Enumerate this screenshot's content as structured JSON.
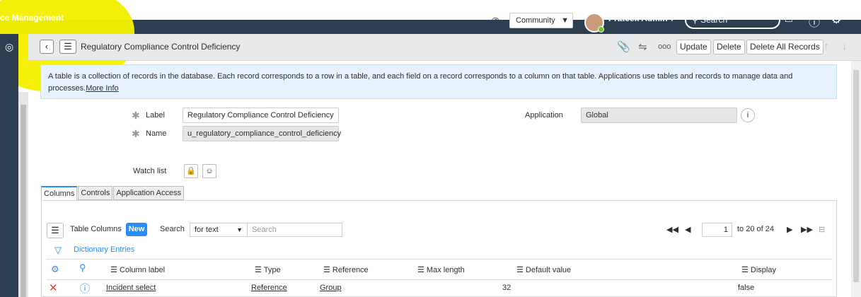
{
  "nav": {
    "app_title": "ce Management",
    "domain_select": "Community",
    "user_name": "Prateek Admin",
    "search_placeholder": "Search"
  },
  "header": {
    "title": "Regulatory Compliance Control Deficiency",
    "update_label": "Update",
    "delete_label": "Delete",
    "delete_all_label": "Delete All Records",
    "more_label": "ooo"
  },
  "info": {
    "text": "A table is a collection of records in the database. Each record corresponds to a row in a table, and each field on a record corresponds to a column on that table. Applications use tables and records to manage data and processes.",
    "link": "More Info"
  },
  "form": {
    "label_label": "Label",
    "label_value": "Regulatory Compliance Control Deficiency",
    "name_label": "Name",
    "name_value": "u_regulatory_compliance_control_deficiency",
    "application_label": "Application",
    "application_value": "Global",
    "watchlist_label": "Watch list"
  },
  "tabs": [
    "Columns",
    "Controls",
    "Application Access"
  ],
  "list": {
    "title": "Table Columns",
    "new_label": "New",
    "search_label": "Search",
    "search_field": "for text",
    "search_placeholder": "Search",
    "page": "1",
    "range": "to 20 of 24",
    "dictionary_link": "Dictionary Entries",
    "columns": [
      "Column label",
      "Type",
      "Reference",
      "Max length",
      "Default value",
      "Display"
    ],
    "rows": [
      {
        "label": "Incident select",
        "type": "Reference",
        "reference": "Group",
        "max_length": "32",
        "default_value": "",
        "display": "false"
      }
    ]
  }
}
